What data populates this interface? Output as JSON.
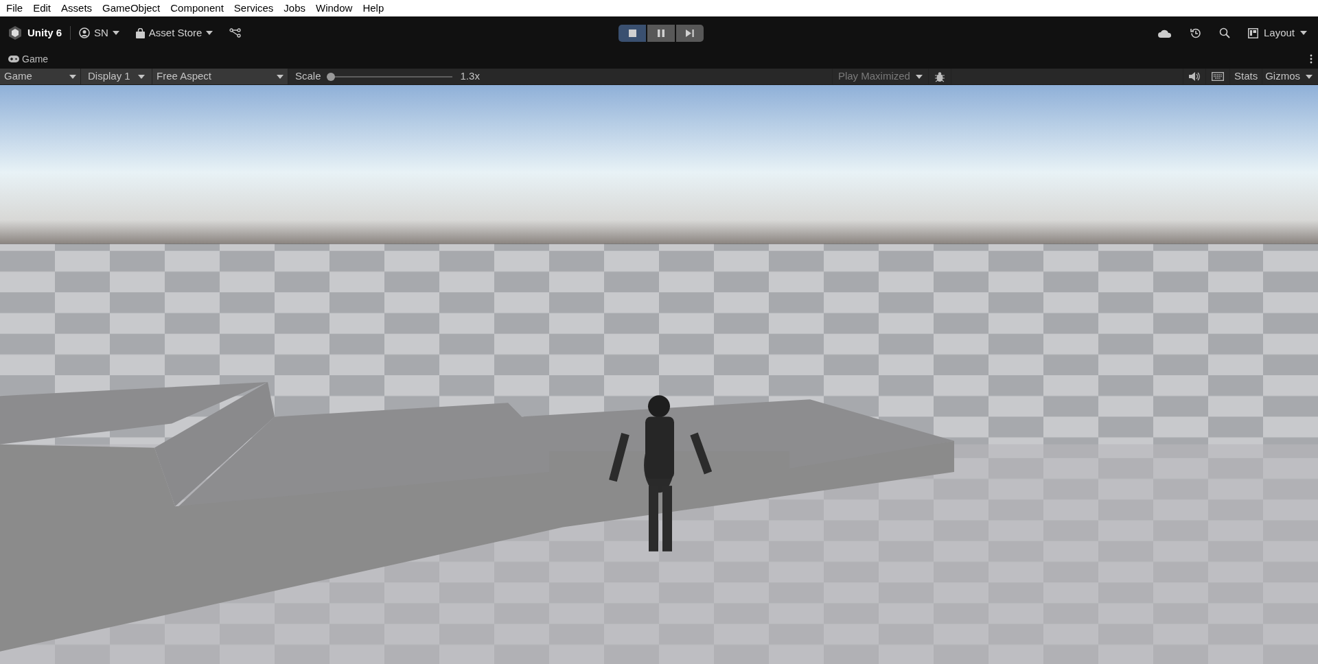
{
  "menu_bar": [
    "File",
    "Edit",
    "Assets",
    "GameObject",
    "Component",
    "Services",
    "Jobs",
    "Window",
    "Help"
  ],
  "toolbar": {
    "title": "Unity 6",
    "account": "SN",
    "asset_store": "Asset Store",
    "layout": "Layout"
  },
  "play_controls": [
    {
      "kind": "stop",
      "selected": true
    },
    {
      "kind": "pause",
      "selected": false
    },
    {
      "kind": "step",
      "selected": false
    }
  ],
  "tab": {
    "label": "Game"
  },
  "game_toolbar": {
    "view": "Game",
    "display": "Display 1",
    "aspect": "Free Aspect",
    "scale_label": "Scale",
    "scale": {
      "level": 0
    },
    "scale_reading": "1.3x",
    "play_mode": "Play Maximized",
    "stats": "Stats",
    "gizmos": "Gizmos"
  }
}
